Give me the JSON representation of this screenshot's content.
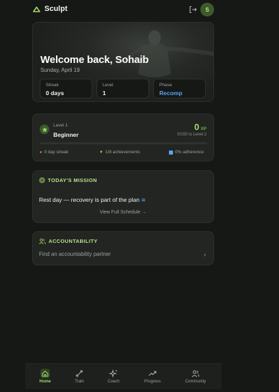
{
  "app": {
    "title": "Sculpt",
    "avatar_initial": "S",
    "accent_color": "#a6d86a",
    "phase_color": "#5aa2f2"
  },
  "hero": {
    "title": "Welcome back, Sohaib",
    "date": "Sunday, April 19",
    "stats": [
      {
        "label": "Streak",
        "value": "0 days"
      },
      {
        "label": "Level",
        "value": "1"
      },
      {
        "label": "Phase",
        "value": "Recomp"
      }
    ]
  },
  "level": {
    "level_label": "Level 1",
    "name": "Beginner",
    "xp": "0",
    "xp_unit": "XP",
    "next": "0/150 to Level 2",
    "progress": 0,
    "streak": "0 day streak",
    "achievements": "1/8 achievements",
    "adherence": "0% adherence"
  },
  "mission": {
    "title": "TODAY'S MISSION",
    "text": "Rest day — recovery is part of the plan",
    "link": "View Full Schedule →"
  },
  "accountability": {
    "title": "ACCOUNTABILITY",
    "link": "Find an accountability partner",
    "chevron": "›"
  },
  "nav": [
    {
      "label": "Home",
      "icon": "home-icon",
      "active": true
    },
    {
      "label": "Train",
      "icon": "dumbbell-icon",
      "active": false
    },
    {
      "label": "Coach",
      "icon": "sparkles-icon",
      "active": false
    },
    {
      "label": "Progress",
      "icon": "trending-up-icon",
      "active": false
    },
    {
      "label": "Community",
      "icon": "users-icon",
      "active": false
    }
  ]
}
